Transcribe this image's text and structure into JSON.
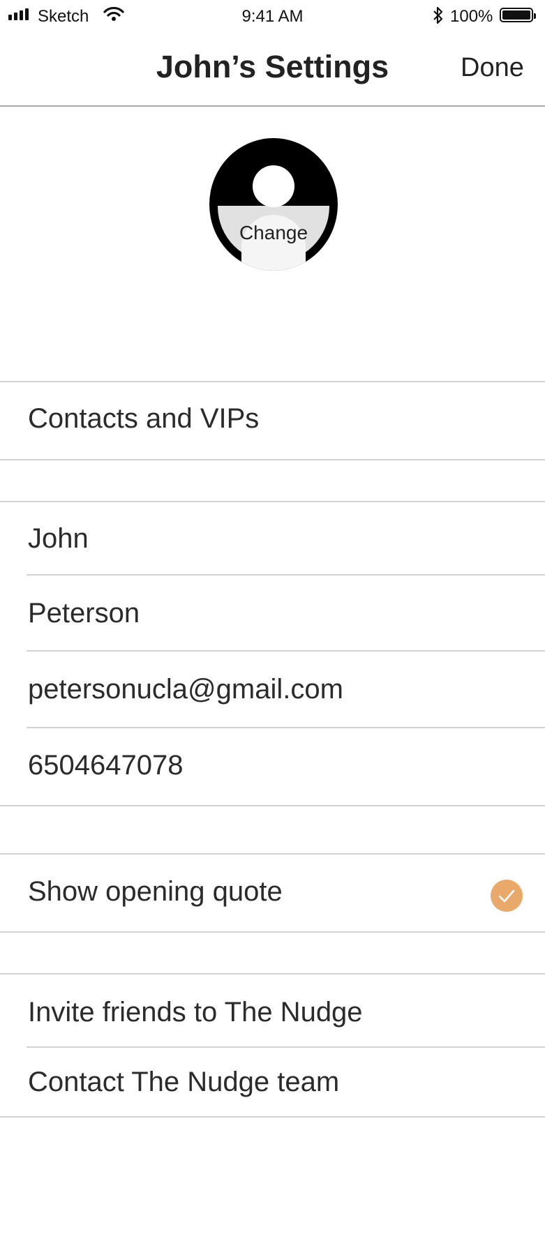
{
  "status_bar": {
    "carrier": "Sketch",
    "time": "9:41 AM",
    "battery_percent": "100%"
  },
  "nav": {
    "title": "John’s Settings",
    "done_label": "Done"
  },
  "avatar": {
    "change_label": "Change"
  },
  "contacts": {
    "label": "Contacts and VIPs"
  },
  "profile": {
    "first_name": "John",
    "last_name": "Peterson",
    "email": "petersonucla@gmail.com",
    "phone": "6504647078"
  },
  "preferences": {
    "show_quote_label": "Show opening quote",
    "show_quote_checked": true,
    "check_color": "#e8a96a"
  },
  "links": {
    "invite_label": "Invite friends to The Nudge",
    "contact_label": "Contact The Nudge team"
  }
}
